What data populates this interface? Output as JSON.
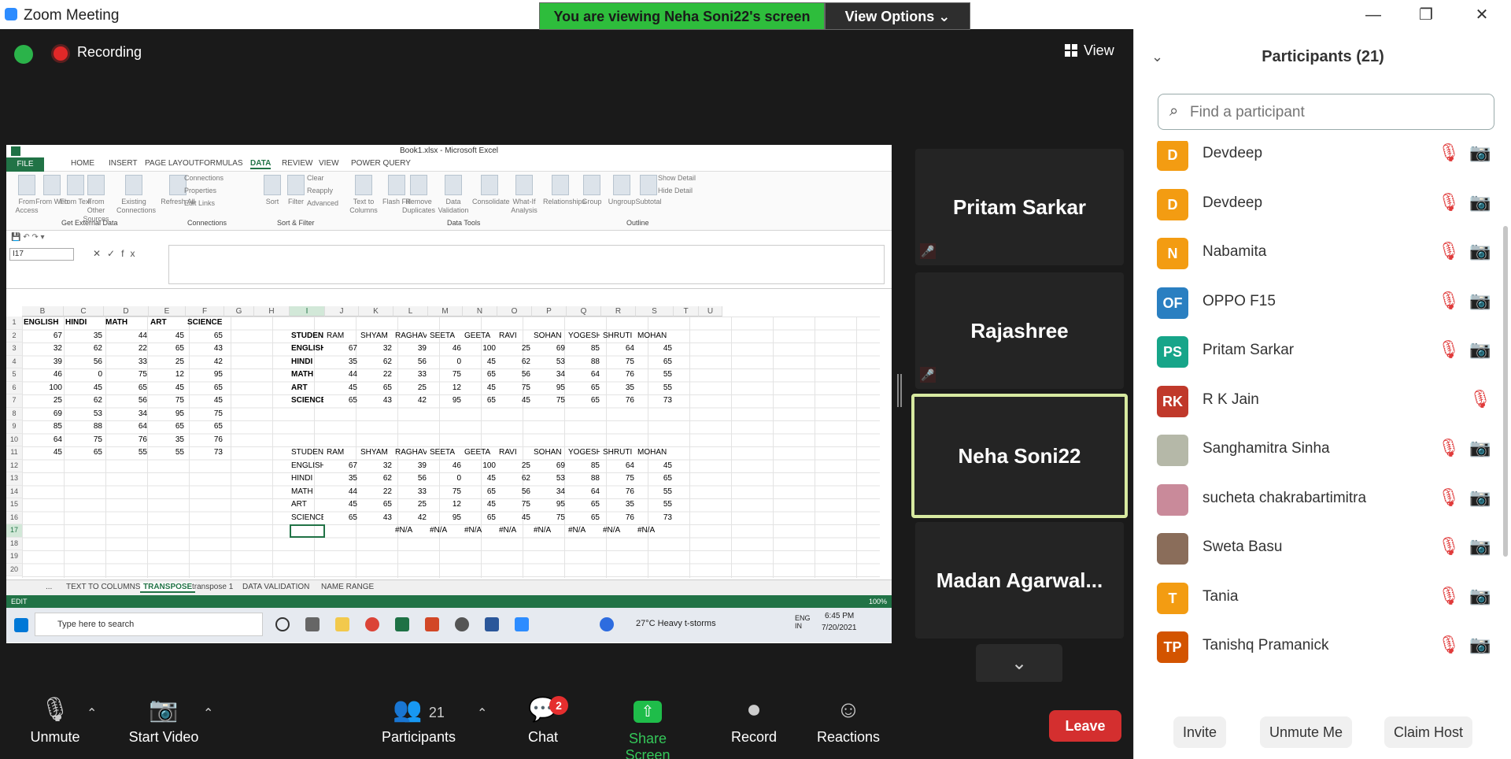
{
  "window": {
    "title": "Zoom Meeting",
    "minimize": "—",
    "restore": "❐",
    "close": "✕"
  },
  "banner": {
    "viewing": "You are viewing Neha Soni22's screen",
    "view_options": "View Options ⌄"
  },
  "recording": {
    "label": "Recording"
  },
  "view_button": {
    "label": "View"
  },
  "excel": {
    "title": "Book1.xlsx - Microsoft Excel",
    "tabs": [
      "FILE",
      "HOME",
      "INSERT",
      "PAGE LAYOUT",
      "FORMULAS",
      "DATA",
      "REVIEW",
      "VIEW",
      "POWER QUERY"
    ],
    "active_tab": "DATA",
    "ribbon": {
      "buttons": [
        "From Access",
        "From Web",
        "From Text",
        "From Other Sources",
        "Existing Connections",
        "Refresh All",
        "Sort",
        "Filter",
        "Text to Columns",
        "Flash Fill",
        "Remove Duplicates",
        "Data Validation",
        "Consolidate",
        "What-If Analysis",
        "Relationships",
        "Group",
        "Ungroup",
        "Subtotal"
      ],
      "small": [
        "Connections",
        "Properties",
        "Edit Links",
        "Clear",
        "Reapply",
        "Advanced",
        "Show Detail",
        "Hide Detail"
      ],
      "groups": [
        "Get External Data",
        "Connections",
        "Sort & Filter",
        "Data Tools",
        "Outline"
      ]
    },
    "name_box": "I17",
    "fx": "fx",
    "columns": [
      "B",
      "C",
      "D",
      "E",
      "F",
      "G",
      "H",
      "I",
      "J",
      "K",
      "L",
      "M",
      "N",
      "O",
      "P",
      "Q",
      "R",
      "S",
      "T",
      "U"
    ],
    "rows": [
      "1",
      "2",
      "3",
      "4",
      "5",
      "6",
      "7",
      "8",
      "9",
      "10",
      "11",
      "12",
      "13",
      "14",
      "15",
      "16",
      "17",
      "18",
      "19",
      "20"
    ],
    "left_table": {
      "headers": [
        "ENGLISH",
        "HINDI",
        "MATH",
        "ART",
        "SCIENCE"
      ],
      "data": [
        [
          67,
          35,
          44,
          45,
          65
        ],
        [
          32,
          62,
          22,
          65,
          43
        ],
        [
          39,
          56,
          33,
          25,
          42
        ],
        [
          46,
          0,
          75,
          12,
          95
        ],
        [
          100,
          45,
          65,
          45,
          65
        ],
        [
          25,
          62,
          56,
          75,
          45
        ],
        [
          69,
          53,
          34,
          95,
          75
        ],
        [
          85,
          88,
          64,
          65,
          65
        ],
        [
          64,
          75,
          76,
          35,
          76
        ],
        [
          45,
          65,
          55,
          55,
          73
        ]
      ]
    },
    "transpose1": {
      "header": [
        "STUDENT",
        "RAM",
        "SHYAM",
        "RAGHAV",
        "SEETA",
        "GEETA",
        "RAVI",
        "SOHAN",
        "YOGESH",
        "SHRUTI",
        "MOHAN"
      ],
      "rows": [
        [
          "ENGLISH",
          67,
          32,
          39,
          46,
          100,
          25,
          69,
          85,
          64,
          45
        ],
        [
          "HINDI",
          35,
          62,
          56,
          0,
          45,
          62,
          53,
          88,
          75,
          65
        ],
        [
          "MATH",
          44,
          22,
          33,
          75,
          65,
          56,
          34,
          64,
          76,
          55
        ],
        [
          "ART",
          45,
          65,
          25,
          12,
          45,
          75,
          95,
          65,
          35,
          55
        ],
        [
          "SCIENCE",
          65,
          43,
          42,
          95,
          65,
          45,
          75,
          65,
          76,
          73
        ]
      ]
    },
    "na_row": [
      "#N/A",
      "#N/A",
      "#N/A",
      "#N/A",
      "#N/A",
      "#N/A",
      "#N/A",
      "#N/A"
    ],
    "sheet_tabs": [
      "...",
      "TEXT TO COLUMNS",
      "TRANSPOSE",
      "transpose 1",
      "DATA VALIDATION",
      "NAME RANGE"
    ],
    "active_sheet": "TRANSPOSE",
    "status": "EDIT",
    "zoom": "100%",
    "taskbar": {
      "search": "Type here to search",
      "weather": "27°C  Heavy t-storms",
      "lang": "ENG IN",
      "time": "6:45 PM",
      "date": "7/20/2021"
    }
  },
  "tiles": [
    {
      "name": "Pritam Sarkar"
    },
    {
      "name": "Rajashree"
    },
    {
      "name": "Neha Soni22"
    },
    {
      "name": "Madan  Agarwal..."
    }
  ],
  "toolbar": {
    "unmute": "Unmute",
    "start_video": "Start Video",
    "participants": "Participants",
    "participants_count": "21",
    "chat": "Chat",
    "chat_badge": "2",
    "share": "Share Screen",
    "record": "Record",
    "reactions": "Reactions",
    "leave": "Leave"
  },
  "panel": {
    "title": "Participants (21)",
    "search_placeholder": "Find a participant",
    "participants": [
      {
        "initials": "D",
        "name": "Devdeep",
        "color": "#f39c12"
      },
      {
        "initials": "D",
        "name": "Devdeep",
        "color": "#f39c12"
      },
      {
        "initials": "N",
        "name": "Nabamita",
        "color": "#f39c12"
      },
      {
        "initials": "OF",
        "name": "OPPO F15",
        "color": "#2a7fc1"
      },
      {
        "initials": "PS",
        "name": "Pritam Sarkar",
        "color": "#17a589"
      },
      {
        "initials": "RK",
        "name": "R K Jain",
        "color": "#c0392b"
      },
      {
        "initials": "",
        "name": "Sanghamitra Sinha",
        "color": "#b5b8a8"
      },
      {
        "initials": "",
        "name": "sucheta chakrabartimitra",
        "color": "#c98a9a"
      },
      {
        "initials": "",
        "name": "Sweta Basu",
        "color": "#8a6d5a"
      },
      {
        "initials": "T",
        "name": "Tania",
        "color": "#f39c12"
      },
      {
        "initials": "TP",
        "name": "Tanishq Pramanick",
        "color": "#d35400"
      }
    ],
    "footer": [
      "Invite",
      "Unmute Me",
      "Claim Host"
    ]
  }
}
